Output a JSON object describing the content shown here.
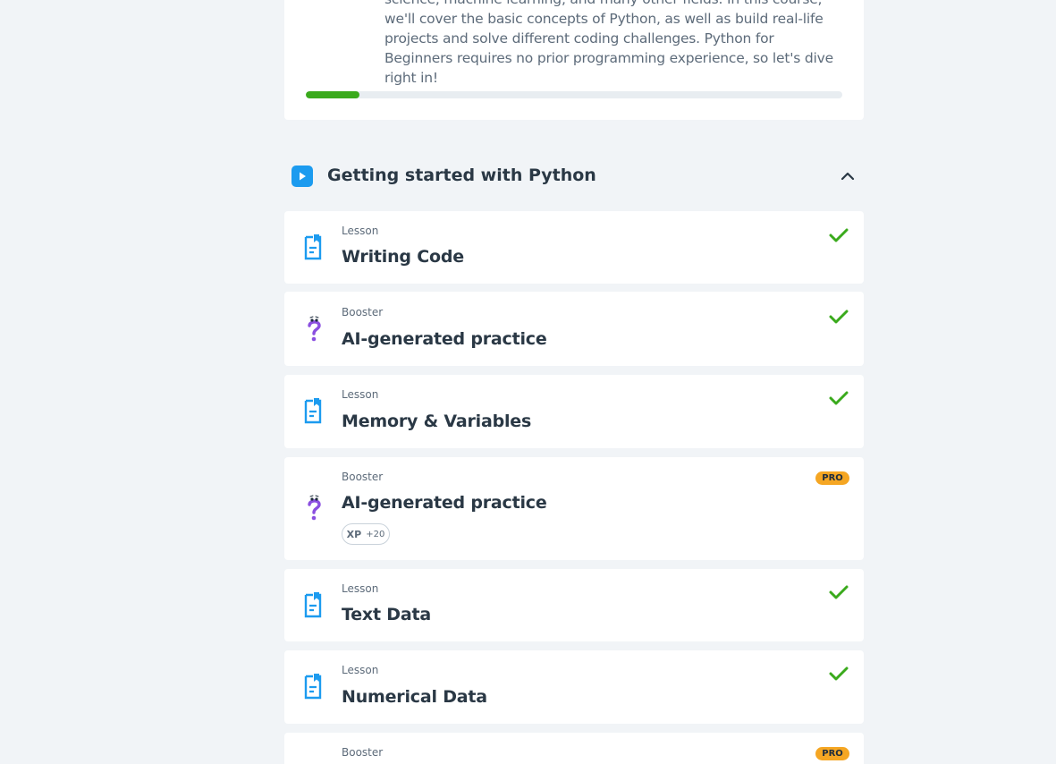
{
  "course": {
    "description": "science, machine learning, and many other fields. In this course, we'll cover the basic concepts of Python, as well as build real-life projects and solve different coding challenges. Python for Beginners requires no prior programming experience, so let's dive right in!",
    "progress_fraction": 0.1
  },
  "section": {
    "title": "Getting started with Python"
  },
  "items": [
    {
      "type": "Lesson",
      "title": "Writing Code",
      "status": "completed"
    },
    {
      "type": "Booster",
      "title": "AI-generated practice",
      "status": "completed"
    },
    {
      "type": "Lesson",
      "title": "Memory & Variables",
      "status": "completed"
    },
    {
      "type": "Booster",
      "title": "AI-generated practice",
      "status": "pro",
      "badge": "PRO",
      "xp_label": "XP",
      "xp_value": "+20"
    },
    {
      "type": "Lesson",
      "title": "Text Data",
      "status": "completed"
    },
    {
      "type": "Lesson",
      "title": "Numerical Data",
      "status": "completed"
    },
    {
      "type": "Booster",
      "title": "",
      "status": "pro",
      "badge": "PRO"
    }
  ],
  "colors": {
    "accent_blue": "#1c9bef",
    "success_green": "#3aaa1c",
    "pro_orange": "#f5a623",
    "booster_purple": "#8b4fe0"
  }
}
